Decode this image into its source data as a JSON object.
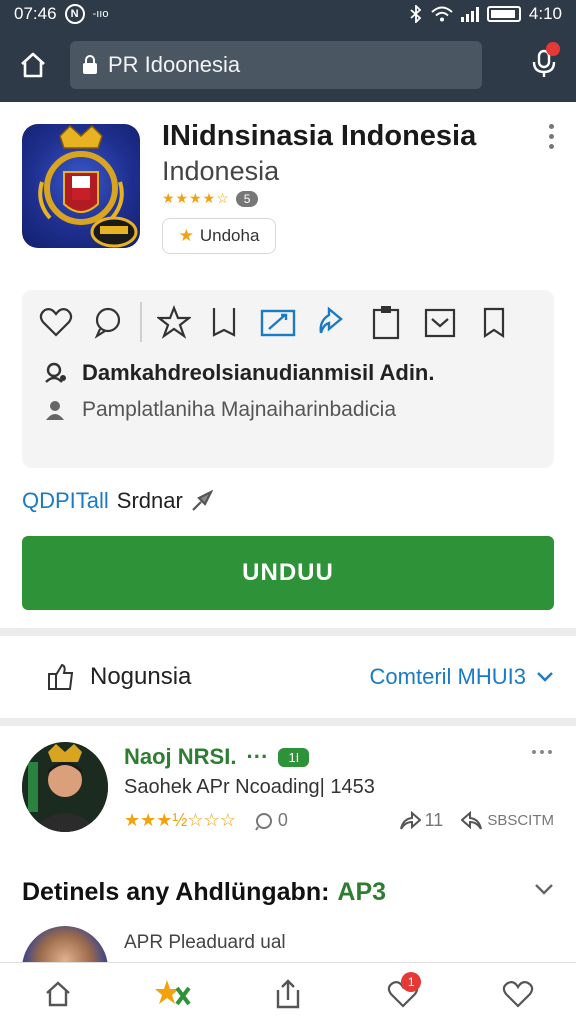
{
  "status_bar": {
    "time": "07:46",
    "indicator": "N",
    "small_text": "-ııo",
    "clock_right": "4:10"
  },
  "browser": {
    "url": "PR Idoonesia",
    "icons": {
      "home": "home-icon",
      "lock": "lock-icon",
      "mic": "mic-icon"
    }
  },
  "app": {
    "title": "INidnsinasia Indonesia",
    "subtitle": "Indonesia",
    "rating_stars": "★★★★☆",
    "rating_count": "5",
    "chip_label": "Undoha"
  },
  "actions": {
    "icons": [
      "heart-icon",
      "chat-icon",
      "star-icon",
      "bookmark-icon",
      "edit-icon",
      "share-icon",
      "clipboard-icon",
      "mail-icon",
      "flag-icon"
    ],
    "line1": "Damkahdreolsianudianmisil Adin.",
    "line2": "Pamplatlaniha Majnaiharinbadicia"
  },
  "link_row": {
    "blue_text": "QDPITall",
    "dark_text": "Srdnar"
  },
  "download_button": "UNDUU",
  "section_bar": {
    "title": "Nogunsia",
    "right_label": "Comteril MHUI3"
  },
  "review": {
    "name": "Naoj NRSI.",
    "badge": "1I",
    "text": "Saohek APr Ncoading| 1453",
    "stars": "★★★½☆☆☆",
    "comments": "0",
    "shares": "11",
    "report": "SBSCITM"
  },
  "details": {
    "title": "Detinels any Ahdlüngabn:",
    "title_accent": "AP3",
    "sub": "APR Pleaduard ual"
  },
  "bottom_nav": {
    "notif_count": "1"
  },
  "colors": {
    "topbar": "#2e3a47",
    "accent_green": "#2e9338",
    "link_blue": "#1a7bc4",
    "star": "#f2a20c"
  }
}
